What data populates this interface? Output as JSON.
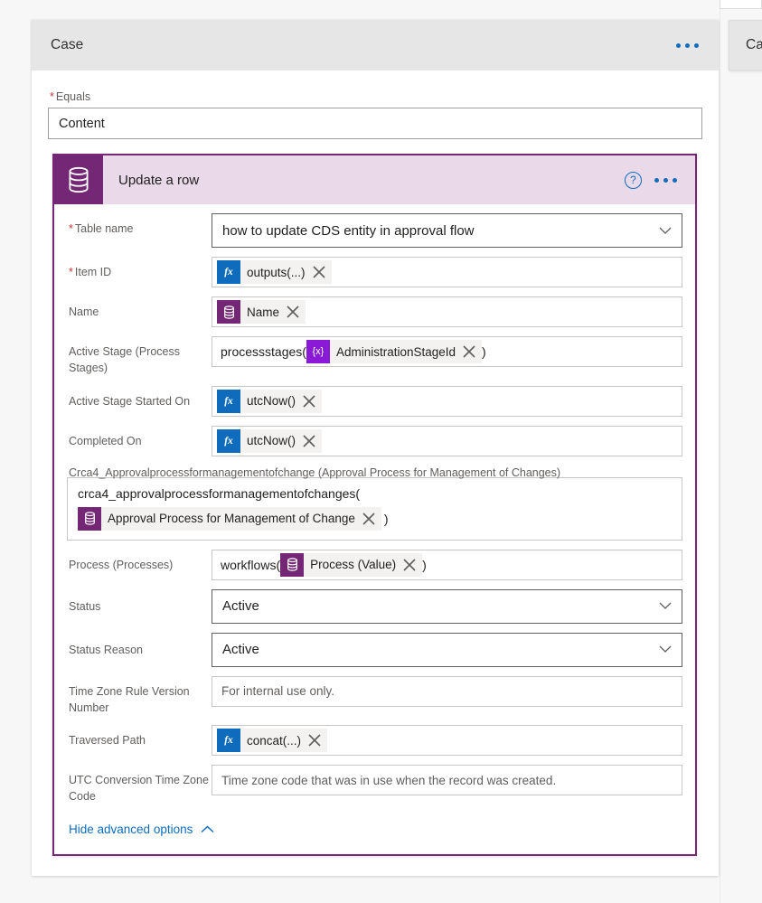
{
  "case_card": {
    "title": "Case",
    "menu_icon": "ellipsis-icon",
    "equals": {
      "label": "Equals",
      "required": true,
      "value": "Content"
    }
  },
  "peek_card": {
    "title": "Cas"
  },
  "action_card": {
    "name": "Update a row",
    "icon": "dataverse-database-icon",
    "help_icon": "help-question-icon",
    "menu_icon": "ellipsis-icon",
    "accent_color": "#742774",
    "header_bg": "#e9d9e9",
    "rows": [
      {
        "label": "Table name",
        "required": true,
        "type": "dropdown",
        "value": "how to update CDS entity in approval flow"
      },
      {
        "label": "Item ID",
        "required": true,
        "type": "token",
        "tokens": [
          {
            "icon": "fx",
            "icon_glyph": "fx",
            "text": "outputs(...)",
            "remove": "close-icon"
          }
        ]
      },
      {
        "label": "Name",
        "required": false,
        "type": "token",
        "tokens": [
          {
            "icon": "dataverse",
            "icon_glyph": "db",
            "text": "Name",
            "remove": "close-icon"
          }
        ]
      },
      {
        "label": "Active Stage (Process Stages)",
        "required": false,
        "type": "mixed",
        "prefix": "processstages(",
        "suffix": ")",
        "tokens": [
          {
            "icon": "variable",
            "icon_glyph": "{x}",
            "text": "AdministrationStageId",
            "remove": "close-icon"
          }
        ]
      },
      {
        "label": "Active Stage Started On",
        "required": false,
        "type": "token",
        "tokens": [
          {
            "icon": "fx",
            "icon_glyph": "fx",
            "text": "utcNow()",
            "remove": "close-icon"
          }
        ]
      },
      {
        "label": "Completed On",
        "required": false,
        "type": "token",
        "tokens": [
          {
            "icon": "fx",
            "icon_glyph": "fx",
            "text": "utcNow()",
            "remove": "close-icon"
          }
        ]
      }
    ],
    "crca4_row": {
      "label": "Crca4_Approvalprocessformanagementofchange (Approval Process for Management of Changes)",
      "expression_line": "crca4_approvalprocessformanagementofchanges(",
      "token": {
        "icon": "dataverse",
        "text": "Approval Process for Management of Change",
        "remove": "close-icon"
      },
      "suffix": ")"
    },
    "process_row": {
      "label": "Process (Processes)",
      "prefix": "workflows(",
      "suffix": ")",
      "token": {
        "icon": "dataverse",
        "text": "Process (Value)",
        "remove": "close-icon"
      }
    },
    "status_row": {
      "label": "Status",
      "value": "Active",
      "type": "dropdown"
    },
    "status_reason_row": {
      "label": "Status Reason",
      "value": "Active",
      "type": "dropdown"
    },
    "tz_rule_row": {
      "label": "Time Zone Rule Version Number",
      "placeholder": "For internal use only."
    },
    "traversed_row": {
      "label": "Traversed Path",
      "token": {
        "icon": "fx",
        "text": "concat(...)",
        "remove": "close-icon"
      }
    },
    "utc_row": {
      "label": "UTC Conversion Time Zone Code",
      "placeholder": "Time zone code that was in use when the record was created."
    },
    "advanced_link": {
      "text": "Hide advanced options",
      "icon": "chevron-up-icon"
    }
  }
}
